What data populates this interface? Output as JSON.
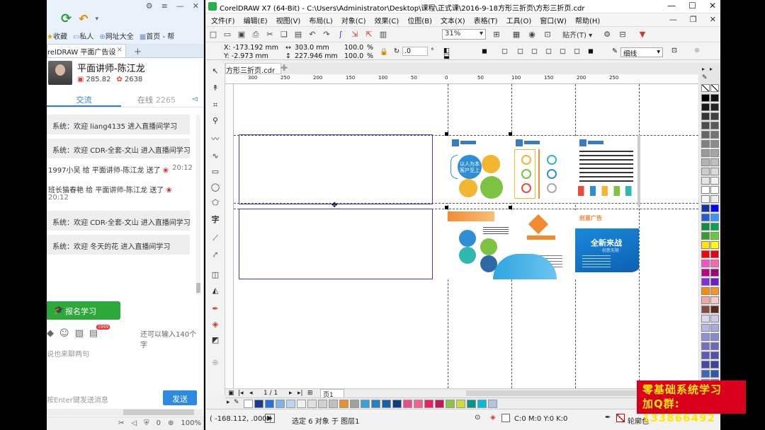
{
  "chat": {
    "favs": [
      "收藏",
      "私人",
      "网址大全",
      "首页 - 帮"
    ],
    "tab_title": "relDRAW 平面广告设",
    "tab_add": "+",
    "host_name": "平面讲师-陈江龙",
    "stat_money": "285.82",
    "stat_flowers": "2638",
    "tab_chat": "交流",
    "tab_online": "在线",
    "online_count": "2265",
    "messages": [
      {
        "type": "sys",
        "text": "系统：欢迎 liang4135  进入直播间学习"
      },
      {
        "type": "sys",
        "text": "系统：欢迎 CDR-全套-文山  进入直播间学习"
      },
      {
        "type": "gift",
        "text": "1997小吴 给  平面讲师-陈江龙  送了",
        "time": "20:12"
      },
      {
        "type": "gift",
        "text": "班长猫春艳 给  平面讲师-陈江龙  送了",
        "time": ""
      },
      {
        "type": "time",
        "text": "20:12"
      },
      {
        "type": "sys",
        "text": "系统：欢迎 CDR-全套-文山  进入直播间学习"
      },
      {
        "type": "sys",
        "text": "系统：欢迎 冬天的花  进入直播间学习"
      }
    ],
    "enroll_label": "报名学习",
    "char_hint": "还可以输入140个字",
    "badge": "1999",
    "input_placeholder": "说也来聊两句",
    "send_hint": "按Enter键发送消息",
    "send_label": "发送",
    "status_items": [
      "0",
      "100%"
    ]
  },
  "corel": {
    "title": "CorelDRAW X7 (64-Bit) - C:\\Users\\Administrator\\Desktop\\课程\\正式课\\2016-9-18方形三折页\\方形三折页.cdr",
    "menus": [
      "文件(F)",
      "编辑(E)",
      "视图(V)",
      "布局(L)",
      "对象(C)",
      "效果(C)",
      "位图(B)",
      "文本(X)",
      "表格(T)",
      "工具(O)",
      "窗口(W)",
      "帮助(H)"
    ],
    "zoom": "31%",
    "snap": "贴齐(T)",
    "x": "X:  -173.192 mm",
    "y": "Y:  -2.973 mm",
    "w": "303.0 mm",
    "h": "227.946 mm",
    "sx": "100.0",
    "sy": "100.0",
    "pct": "%",
    "angle": ".0",
    "outline": "细线",
    "doc_tab": "方形三折页.cdr",
    "ruler_labels": [
      "300",
      "250",
      "200",
      "150",
      "100",
      "50",
      "0",
      "50",
      "100",
      "150",
      "200",
      "250"
    ],
    "page_nav": "1 / 1",
    "page_tab": "页1",
    "status_coords": "( -168.112, .000 )",
    "status_sel": "选定 6 对象 于 图层1",
    "status_color": "C:0 M:0 Y:0 K:0",
    "status_outline": "轮廓色",
    "panel1_lines": [
      "以人为本",
      "客户至上"
    ],
    "panel_brand": "创意广告",
    "panel_slogan": "全新来战",
    "panel_sub": "·  创意无限  ·"
  },
  "watermark": {
    "line1": "零基础系统学习",
    "line2": "加Q群: 133866492"
  },
  "colors": {
    "corel_green": "#27b04a",
    "chat_blue": "#2c8be0",
    "enroll_green": "#2da83a",
    "watermark_red": "#d8001d",
    "watermark_yellow": "#ffe800",
    "frame_blue": "#3d3dc4"
  }
}
